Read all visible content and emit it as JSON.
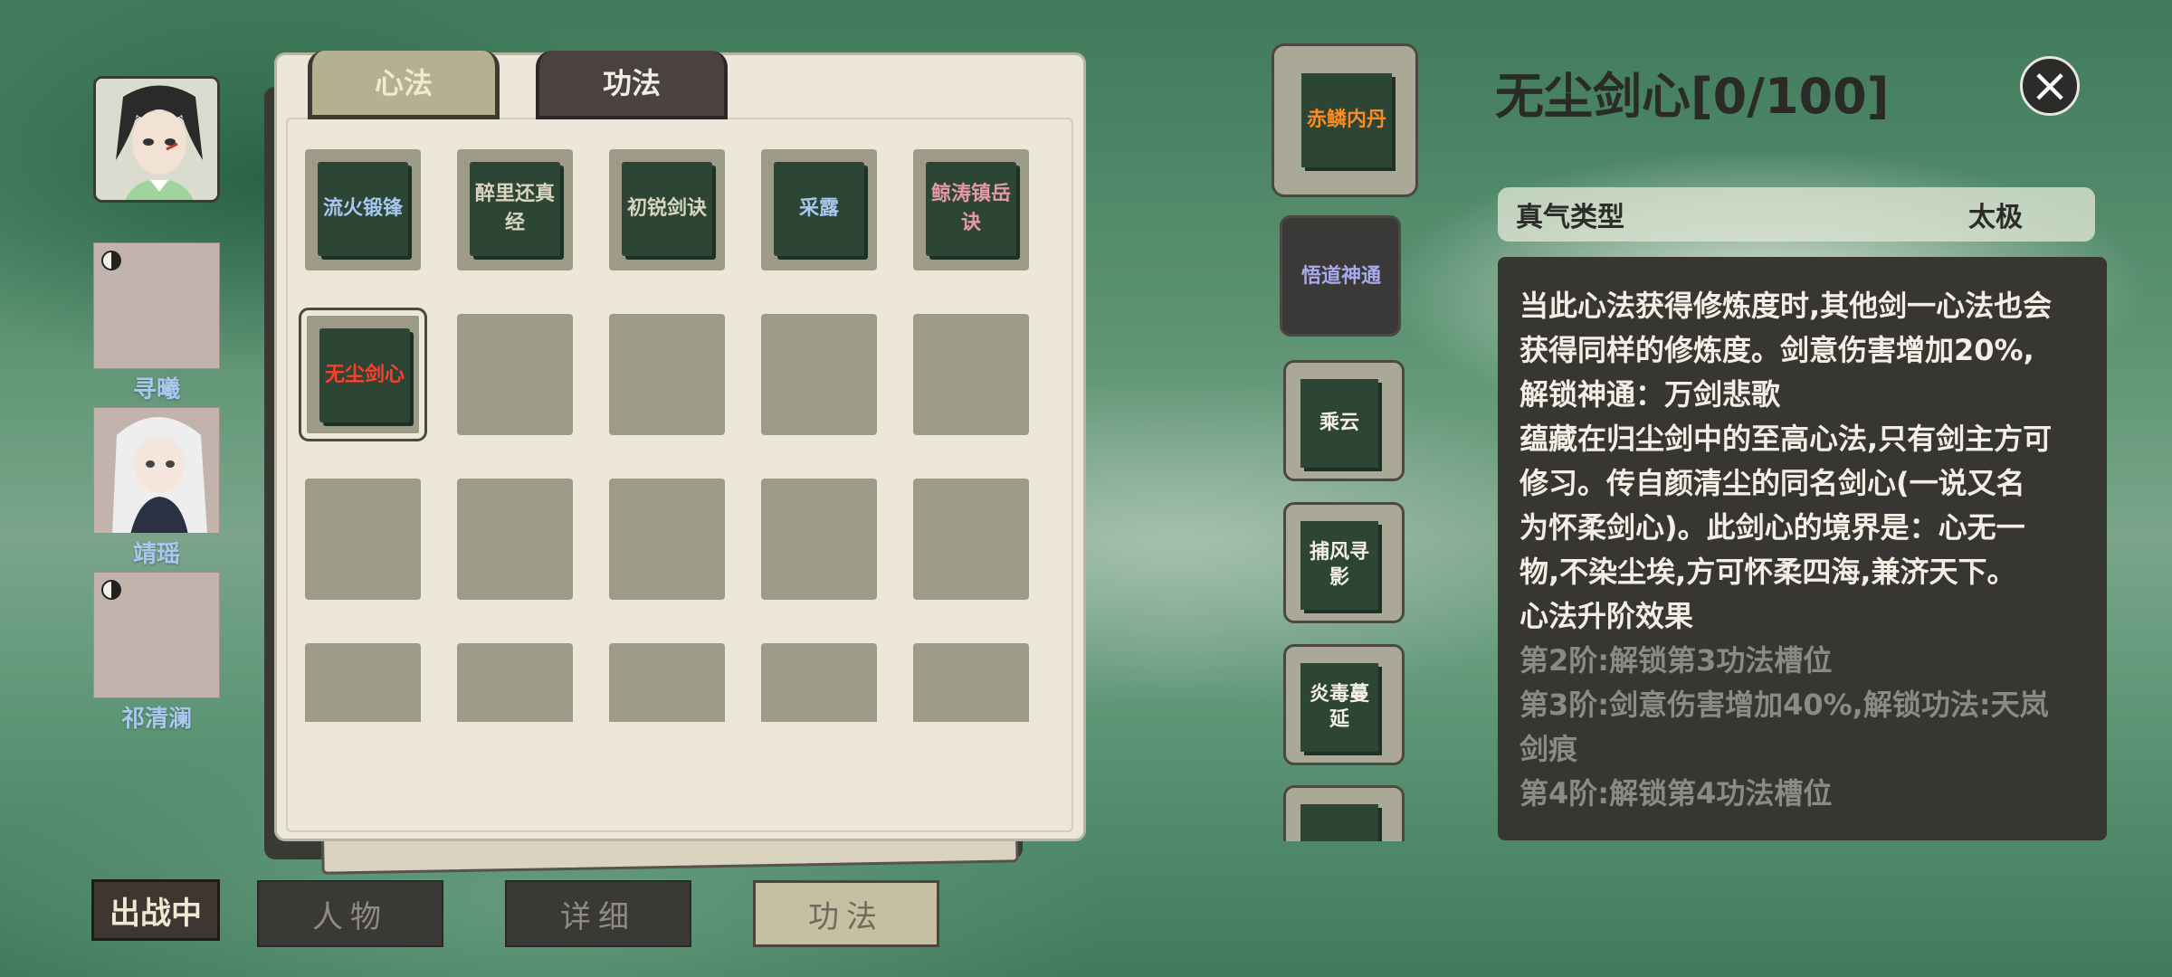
{
  "roster": {
    "members": [
      {
        "name": "寻曦"
      },
      {
        "name": "靖瑶"
      },
      {
        "name": "祁清澜"
      }
    ]
  },
  "tabs": {
    "xinfa": "心法",
    "gongfa": "功法"
  },
  "skills": [
    {
      "name": "流火锻锋",
      "color": "#a9c8f0"
    },
    {
      "name": "醉里还真经",
      "color": "#d9d3c0"
    },
    {
      "name": "初锐剑诀",
      "color": "#d9d3c0"
    },
    {
      "name": "采露",
      "color": "#a9c8f0"
    },
    {
      "name": "鲸涛镇岳诀",
      "color": "#e39aa6"
    },
    {
      "name": "无尘剑心",
      "color": "#ff3d2a"
    }
  ],
  "side_skills": [
    {
      "name": "赤鳞内丹",
      "color": "#ff8a1f"
    },
    {
      "name": "悟道神通",
      "color": "#a9a9f0"
    },
    {
      "name": "乘云",
      "color": "#f3efe5"
    },
    {
      "name": "捕风寻影",
      "color": "#f3efe5"
    },
    {
      "name": "炎毒蔓延",
      "color": "#f3efe5"
    }
  ],
  "detail": {
    "title": "无尘剑心[0/100]",
    "type_label": "真气类型",
    "type_value": "太极",
    "lines": [
      "当此心法获得修炼度时,其他剑一心法也会",
      "获得同样的修炼度。剑意伤害增加20%,",
      "解锁神通：万剑悲歌",
      "蕴藏在归尘剑中的至高心法,只有剑主方可",
      "修习。传自颜清尘的同名剑心(一说又名",
      "为怀柔剑心)。此剑心的境界是：心无一",
      "物,不染尘埃,方可怀柔四海,兼济天下。",
      "心法升阶效果"
    ],
    "dim_lines": [
      "第2阶:解锁第3功法槽位",
      "第3阶:剑意伤害增加40%,解锁功法:天岚",
      "剑痕",
      "第4阶:解锁第4功法槽位"
    ]
  },
  "bottom": {
    "status": "出战中",
    "btn_character": "人物",
    "btn_detail": "详细",
    "btn_gongfa": "功法"
  }
}
